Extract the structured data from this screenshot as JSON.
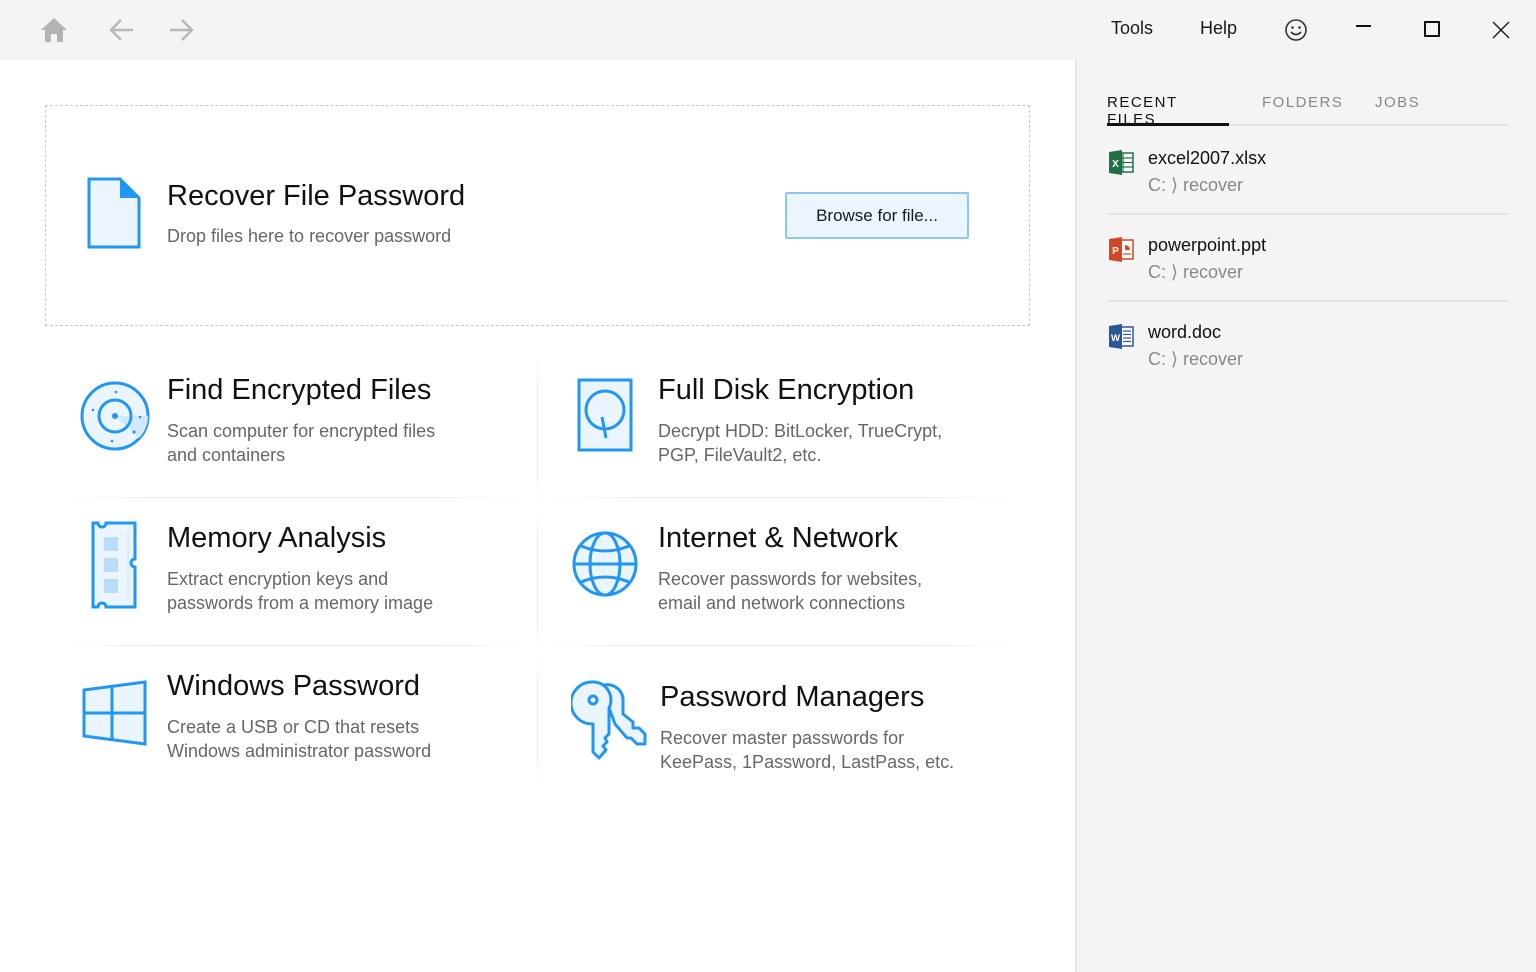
{
  "titlebar": {
    "nav": {
      "home": "home-icon",
      "back": "arrow-left-icon",
      "forward": "arrow-right-icon"
    },
    "menu": {
      "tools": "Tools",
      "help": "Help"
    },
    "icons": {
      "feedback": "smiley-icon",
      "minimize": "minimize-icon",
      "maximize": "maximize-icon",
      "close": "close-icon"
    }
  },
  "dropzone": {
    "title": "Recover File Password",
    "subtitle": "Drop files here to recover password",
    "browse_label": "Browse for file..."
  },
  "cards": [
    {
      "title": "Find Encrypted Files",
      "desc1": "Scan computer for encrypted files",
      "desc2": "and containers",
      "icon": "radar-icon"
    },
    {
      "title": "Full Disk Encryption",
      "desc1": "Decrypt HDD: BitLocker, TrueCrypt,",
      "desc2": "PGP, FileVault2, etc.",
      "icon": "hard-disk-icon"
    },
    {
      "title": "Memory Analysis",
      "desc1": "Extract encryption keys and",
      "desc2": "passwords from a memory image",
      "icon": "memory-chip-icon"
    },
    {
      "title": "Internet & Network",
      "desc1": "Recover passwords for websites,",
      "desc2": "email and network connections",
      "icon": "globe-icon"
    },
    {
      "title": "Windows Password",
      "desc1": "Create a USB or CD that resets",
      "desc2": "Windows administrator password",
      "icon": "windows-logo-icon"
    },
    {
      "title": "Password Managers",
      "desc1": "Recover master passwords for",
      "desc2": "KeePass, 1Password, LastPass, etc.",
      "icon": "keys-icon"
    }
  ],
  "sidebar": {
    "tabs": [
      {
        "label": "RECENT FILES",
        "active": true
      },
      {
        "label": "FOLDERS",
        "active": false
      },
      {
        "label": "JOBS",
        "active": false
      }
    ],
    "recent_files": [
      {
        "name": "excel2007.xlsx",
        "path": "C: ⟩ recover",
        "type": "excel",
        "color": "#1e7145"
      },
      {
        "name": "powerpoint.ppt",
        "path": "C: ⟩ recover",
        "type": "powerpoint",
        "color": "#d24726"
      },
      {
        "name": "word.doc",
        "path": "C: ⟩ recover",
        "type": "word",
        "color": "#2b579a"
      }
    ]
  },
  "colors": {
    "accent": "#2196f3",
    "accent_fill": "#eaf5ff",
    "button_border": "#8cc7f0"
  }
}
